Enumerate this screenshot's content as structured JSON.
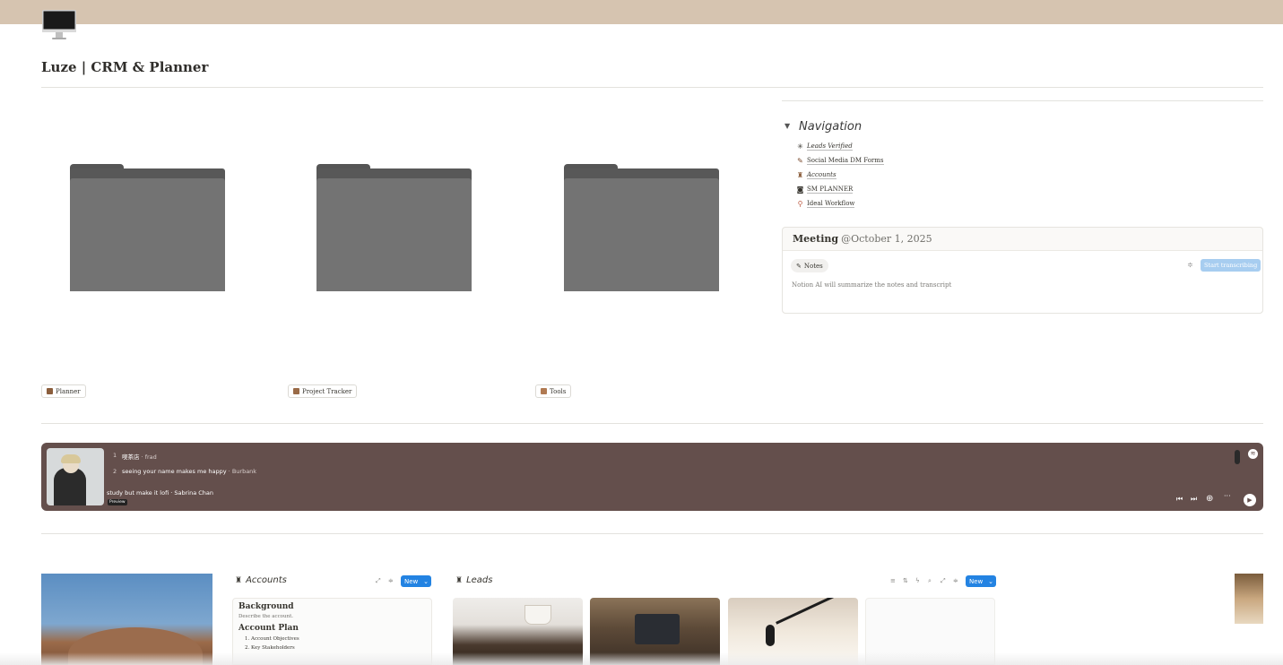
{
  "page": {
    "title": "Luze | CRM & Planner",
    "icon": "imac-icon",
    "cover_color": "#d6c4b0"
  },
  "folders": [
    {
      "label": "Planner",
      "icon": "book-icon"
    },
    {
      "label": "Project Tracker",
      "icon": "calendar-icon"
    },
    {
      "label": "Tools",
      "icon": "wrench-icon"
    }
  ],
  "navigation": {
    "heading": "Navigation",
    "items": [
      {
        "label": "Leads Verified",
        "icon": "sparkle-icon",
        "italic": true
      },
      {
        "label": "Social Media DM Forms",
        "icon": "brush-icon",
        "italic": false
      },
      {
        "label": "Accounts",
        "icon": "bag-icon",
        "italic": true
      },
      {
        "label": "SM PLANNER",
        "icon": "camera-icon",
        "italic": false
      },
      {
        "label": "Ideal Workflow",
        "icon": "runner-icon",
        "italic": false
      }
    ]
  },
  "meeting": {
    "title": "Meeting",
    "date": "@October 1, 2025",
    "notes_tab": "Notes",
    "start_button": "Start transcribing",
    "ai_text": "Notion AI will summarize the notes and transcript"
  },
  "player": {
    "background": "#644f4c",
    "tracks": [
      {
        "num": "1",
        "title": "喫茶店",
        "artist": "frad"
      },
      {
        "num": "2",
        "title": "seeing your name makes me happy",
        "artist": "Burbank"
      }
    ],
    "playlist": "study but make it lofi · Sabrina Chan",
    "preview_badge": "Preview"
  },
  "accounts": {
    "title": "Accounts",
    "new_label": "New",
    "card": {
      "heading1": "Background",
      "desc": "Describe the account.",
      "heading2": "Account Plan",
      "list": [
        "Account Objectives",
        "Key Stakeholders"
      ]
    }
  },
  "leads": {
    "title": "Leads",
    "new_label": "New"
  }
}
